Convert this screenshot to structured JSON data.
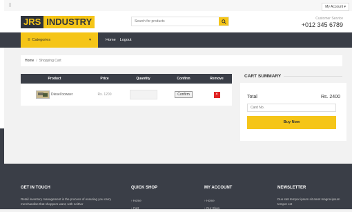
{
  "header": {
    "account_label": "My Account",
    "logo_left": "JRS",
    "logo_right": "INDUSTRY",
    "search_placeholder": "Search for products",
    "customer_service_label": "Customer Service",
    "phone": "+012 345 6789"
  },
  "nav": {
    "categories_label": "Categories",
    "links": [
      "Home",
      "Logout"
    ]
  },
  "breadcrumb": {
    "home": "Home",
    "separator": "/",
    "current": "Shopping Cart"
  },
  "cart": {
    "columns": [
      "Product",
      "Price",
      "Quantity",
      "Confirm",
      "Remove"
    ],
    "rows": [
      {
        "product": "Diesel bowser",
        "price": "Rs. 1200",
        "quantity": "",
        "confirm_label": "Confirm",
        "remove_label": "×"
      }
    ]
  },
  "summary": {
    "title": "CART SUMMARY",
    "total_label": "Total",
    "total_value": "Rs. 2400",
    "card_placeholder": "Card No.",
    "buy_label": "Buy Now"
  },
  "footer": {
    "get_in_touch": {
      "title": "GET IN TOUCH",
      "text": "Retail inventory management is the process of ensuring you carry merchandise that shoppers want, with neither"
    },
    "quick_shop": {
      "title": "QUICK SHOP",
      "links": [
        "Home",
        "Cart"
      ]
    },
    "my_account": {
      "title": "MY ACCOUNT",
      "links": [
        "Home",
        "Our Shop"
      ]
    },
    "newsletter": {
      "title": "NEWSLETTER",
      "text": "Duo stet tempor ipsum sit amet magna ipsum tempor est"
    }
  },
  "colors": {
    "accent": "#f5c518",
    "dark": "#3a3e47",
    "danger": "#e02424"
  }
}
